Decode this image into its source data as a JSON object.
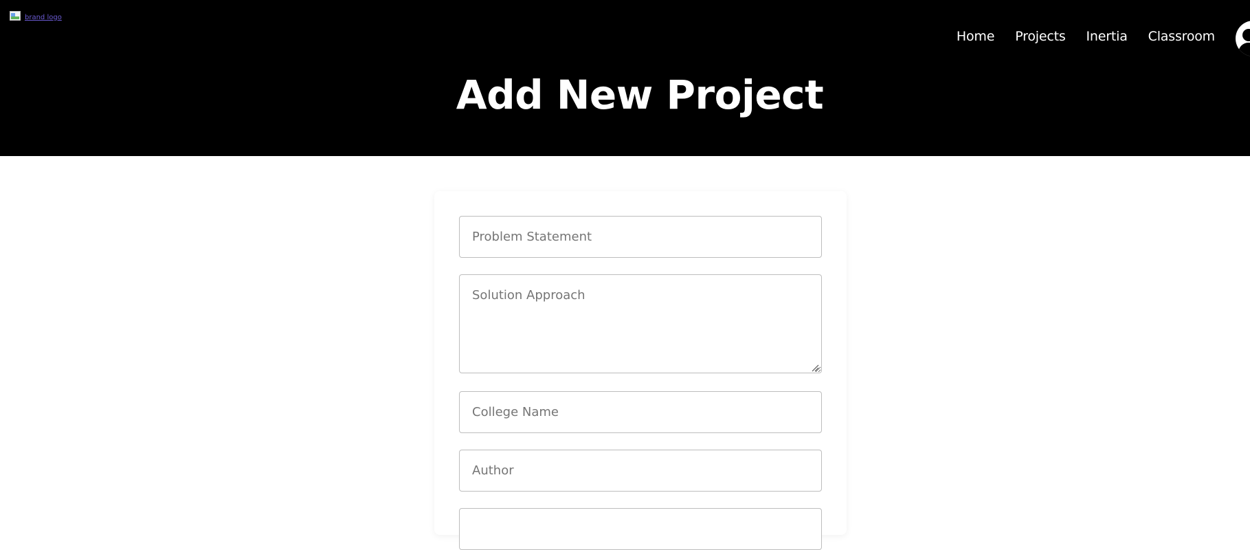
{
  "header": {
    "logo_alt": "brand logo",
    "nav": [
      {
        "label": "Home"
      },
      {
        "label": "Projects"
      },
      {
        "label": "Inertia"
      },
      {
        "label": "Classroom"
      }
    ],
    "title": "Add New Project"
  },
  "form": {
    "problem_statement": {
      "placeholder": "Problem Statement",
      "value": ""
    },
    "solution_approach": {
      "placeholder": "Solution Approach",
      "value": ""
    },
    "college_name": {
      "placeholder": "College Name",
      "value": ""
    },
    "author": {
      "placeholder": "Author",
      "value": ""
    }
  },
  "icons": {
    "logo": "broken-image-icon",
    "avatar": "user-avatar-icon",
    "resize": "resize-handle-icon"
  },
  "colors": {
    "header_bg": "#000000",
    "header_text": "#ffffff",
    "page_bg": "#ffffff",
    "field_border": "#bdbdbd",
    "placeholder": "#757575"
  }
}
